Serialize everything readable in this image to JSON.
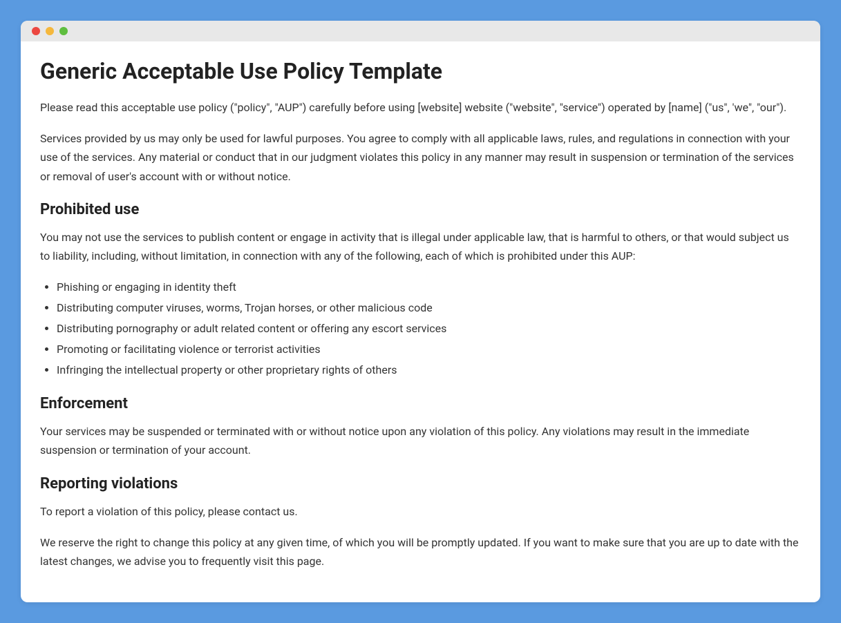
{
  "title": "Generic Acceptable Use Policy Template",
  "intro_paragraph_1": "Please read this acceptable use policy (\"policy\", \"AUP\") carefully before using [website] website (\"website\", \"service\") operated by [name] (\"us\", 'we\", \"our\").",
  "intro_paragraph_2": "Services provided by us may only be used for lawful purposes. You agree to comply with all applicable laws, rules, and regulations in connection with your use of the services. Any material or conduct that in our judgment violates this policy in any manner may result in suspension or termination of the services or removal of user's account with or without notice.",
  "sections": {
    "prohibited": {
      "heading": "Prohibited use",
      "paragraph": "You may not use the services to publish content or engage in activity that is illegal under applicable law, that is harmful to others, or that would subject us to liability, including, without limitation, in connection with any of the following, each of which is prohibited under this AUP:",
      "items": [
        "Phishing or engaging in identity theft",
        "Distributing computer viruses, worms, Trojan horses, or other malicious code",
        "Distributing pornography or adult related content or offering any escort services",
        "Promoting or facilitating violence or terrorist activities",
        "Infringing the intellectual property or other proprietary rights of others"
      ]
    },
    "enforcement": {
      "heading": "Enforcement",
      "paragraph": "Your services may be suspended or terminated with or without notice upon any violation of this policy. Any violations may result in the immediate suspension or termination of your account."
    },
    "reporting": {
      "heading": "Reporting violations",
      "paragraph_1": "To report a violation of this policy, please contact us.",
      "paragraph_2": "We reserve the right to change this policy at any given time, of which you will be promptly updated. If you want to make sure that you are up to date with the latest changes, we advise you to frequently visit this page."
    }
  }
}
